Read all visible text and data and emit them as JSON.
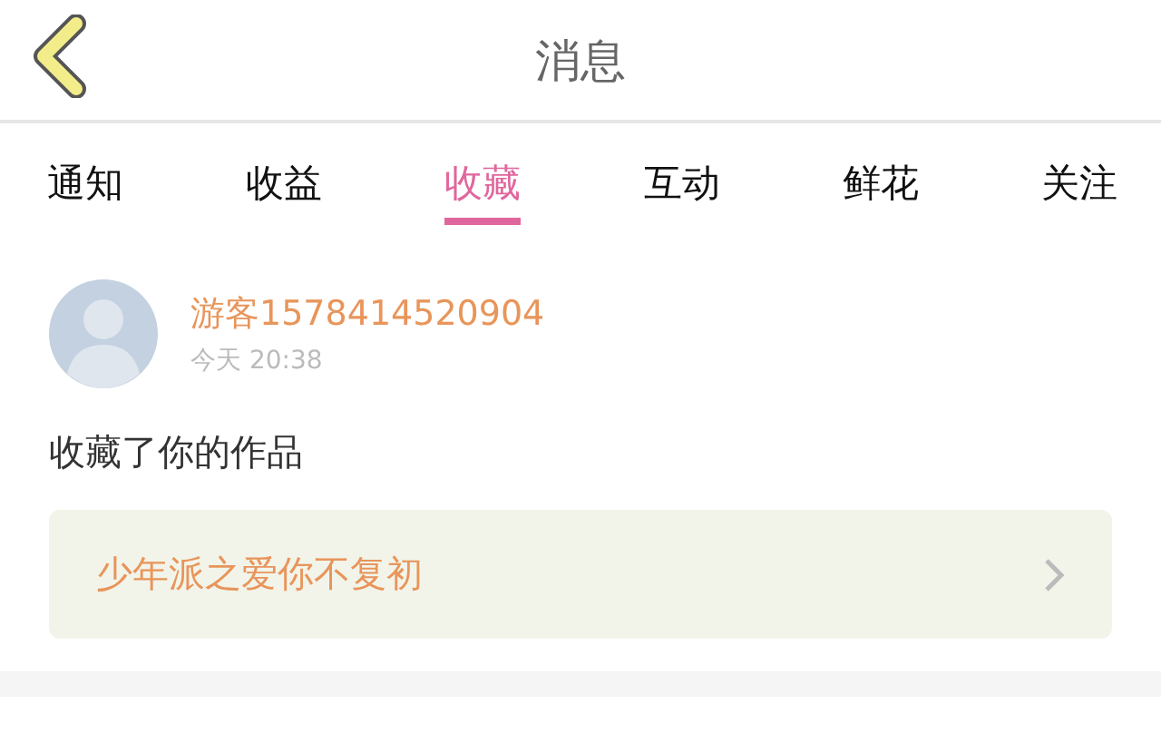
{
  "header": {
    "title": "消息"
  },
  "tabs": [
    {
      "label": "通知",
      "selected": false
    },
    {
      "label": "收益",
      "selected": false
    },
    {
      "label": "收藏",
      "selected": true
    },
    {
      "label": "互动",
      "selected": false
    },
    {
      "label": "鲜花",
      "selected": false
    },
    {
      "label": "关注",
      "selected": false
    }
  ],
  "messages": [
    {
      "user": "游客1578414520904",
      "time": "今天 20:38",
      "text": "收藏了你的作品",
      "work": "少年派之爱你不复初"
    }
  ]
}
